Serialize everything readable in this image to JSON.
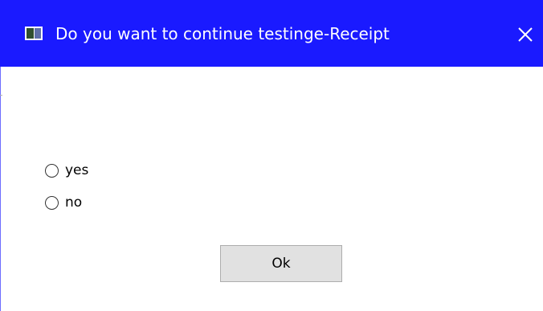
{
  "window": {
    "title": "Do you want to continue testinge-Receipt",
    "icon": "window-app-icon",
    "close_icon": "close-icon"
  },
  "colors": {
    "titlebar": "#1a1aff",
    "background": "#ffffff",
    "button_face": "#e1e1e1",
    "button_border": "#adadad"
  },
  "options": [
    {
      "label": "yes",
      "selected": false
    },
    {
      "label": "no",
      "selected": false
    }
  ],
  "ok_button": {
    "label": "Ok"
  }
}
